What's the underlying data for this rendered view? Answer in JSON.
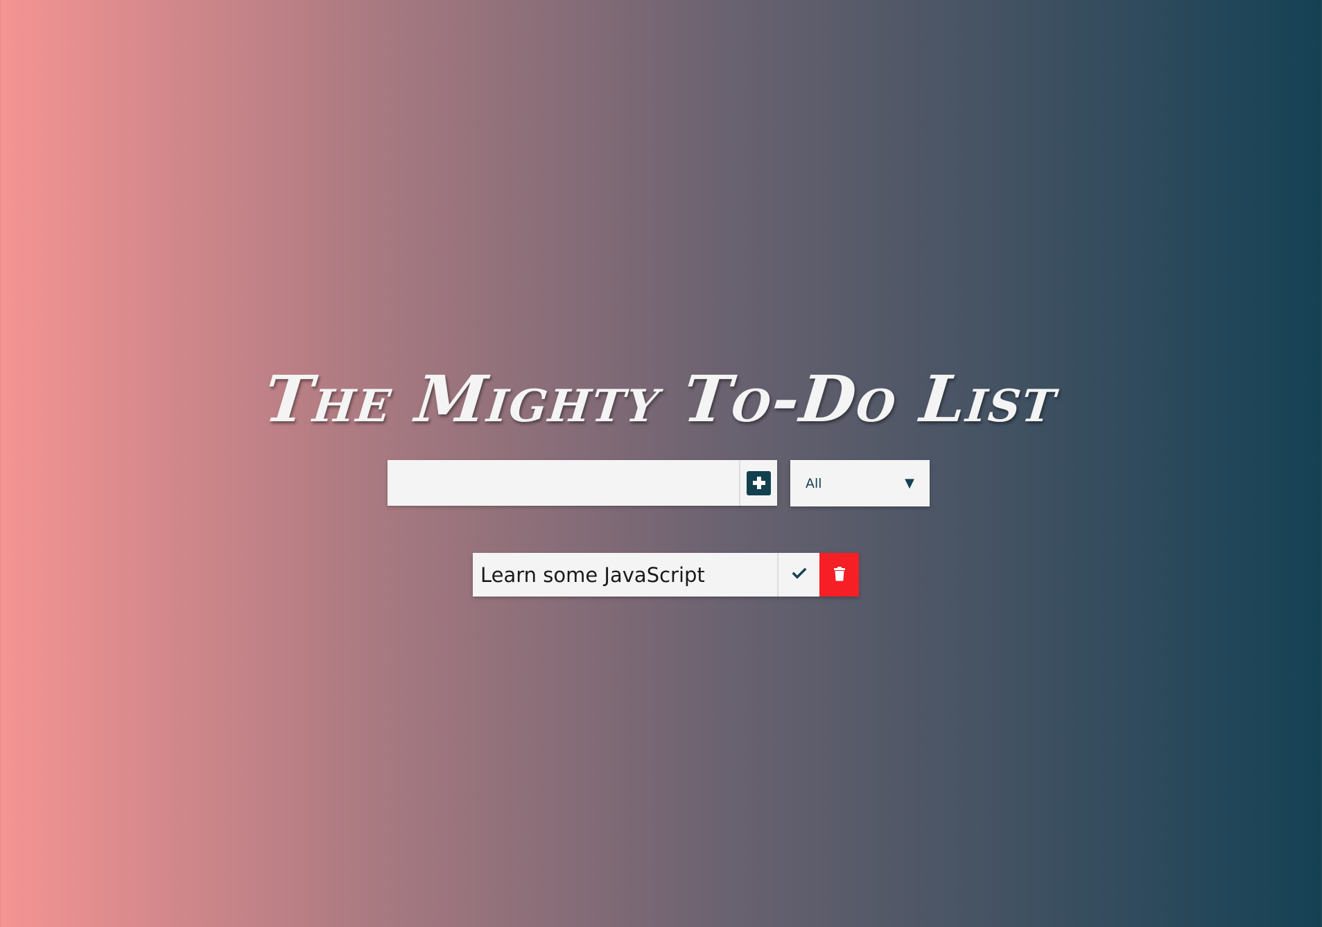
{
  "header": {
    "title": "The Mighty To-Do List"
  },
  "form": {
    "input_value": "",
    "input_placeholder": "",
    "add_icon": "plus-square-icon",
    "filter": {
      "selected": "All",
      "arrow_icon": "triangle-down-icon"
    }
  },
  "todos": [
    {
      "text": "Learn some JavaScript",
      "complete_icon": "check-icon",
      "delete_icon": "trash-icon"
    }
  ],
  "colors": {
    "gradient_start": "#f59493",
    "gradient_end": "#154155",
    "accent": "#13404f",
    "delete": "#f61f26",
    "surface": "#f4f4f4"
  }
}
